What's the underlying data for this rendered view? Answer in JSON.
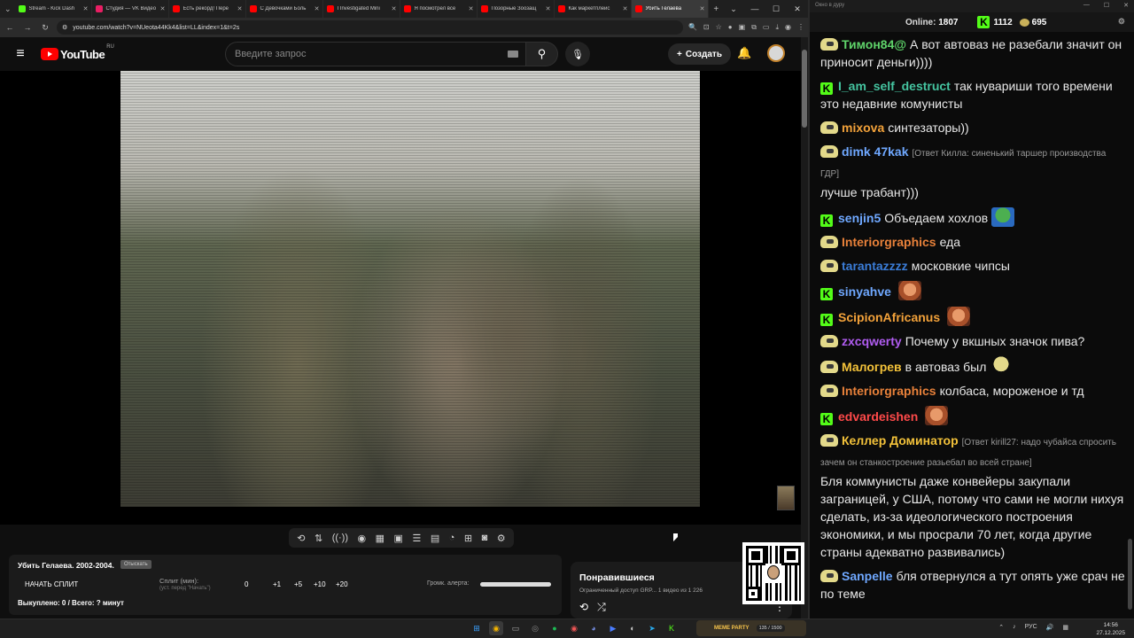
{
  "browser": {
    "tabs": [
      {
        "label": "Stream - Kick Dash",
        "color": "#53fc18"
      },
      {
        "label": "Студия — VK Видео",
        "color": "#e91e63"
      },
      {
        "label": "Есть рекорд! Пере",
        "color": "#ff0000"
      },
      {
        "label": "С Девочками Боль",
        "color": "#ff0000"
      },
      {
        "label": "I Investigated Mini",
        "color": "#ff0000"
      },
      {
        "label": "Я посмотрел все",
        "color": "#ff0000"
      },
      {
        "label": "Позорные Зоозащ",
        "color": "#ff0000"
      },
      {
        "label": "Как маркетплейс",
        "color": "#ff0000"
      },
      {
        "label": "Убить Гелаева",
        "color": "#ff0000"
      }
    ],
    "url": "youtube.com/watch?v=NUeota44Kk4&list=LL&index=1&t=2s"
  },
  "youtube": {
    "logo_text": "YouTube",
    "region": "RU",
    "search_placeholder": "Введите запрос",
    "create_label": "Создать"
  },
  "split_panel": {
    "title": "Убить Гелаева. 2002-2004.",
    "tag": "Отыскать",
    "start_label": "НАЧАТЬ СПЛИТ",
    "split_label": "Сплит (мин):",
    "split_hint": "(уст. перед \"Начать\")",
    "values": [
      "0",
      "+1",
      "+5",
      "+10",
      "+20"
    ],
    "volume_label": "Громк. алерта:",
    "footer": "Выкуплено: 0 / Всего: ? минут"
  },
  "liked_panel": {
    "title": "Понравившиеся",
    "subtitle": "Ограниченный доступ GRP... 1 видео из 1 226"
  },
  "chat": {
    "window_title": "Окно в дуру",
    "online_label": "Online:",
    "online_count": "1807",
    "k_count": "1112",
    "coin_count": "695",
    "messages": [
      {
        "badge": "pepe",
        "user": "Тимон84@",
        "color": "#5fd46a",
        "text": "А вот автоваз не разебали значит он приносит деньги))))",
        "reply": ""
      },
      {
        "badge": "k",
        "user": "I_am_self_destruct",
        "color": "#45c4a0",
        "text": "так нувариши того времени это недавние комунисты",
        "reply": ""
      },
      {
        "badge": "pepe",
        "user": "mixova",
        "color": "#f3a23a",
        "text": "синтезаторы))",
        "reply": ""
      },
      {
        "badge": "pepe",
        "user": "dimk 47kak",
        "color": "#6fa8ff",
        "text": "лучше трабант)))",
        "reply": "[Ответ Килла: синенький таршер производства ГДР]"
      },
      {
        "badge": "k",
        "user": "senjin5",
        "color": "#6fa8ff",
        "text": "Объедаем хохлов",
        "reply": "",
        "emote": "pepe"
      },
      {
        "badge": "pepe",
        "user": "Interiorgraphics",
        "color": "#e8813a",
        "text": "еда",
        "reply": ""
      },
      {
        "badge": "pepe",
        "user": "tarantazzzz",
        "color": "#3b7dd8",
        "text": "московкие чипсы",
        "reply": ""
      },
      {
        "badge": "k",
        "user": "sinyahve",
        "color": "#6fa8ff",
        "text": "",
        "reply": "",
        "emote": "face"
      },
      {
        "badge": "k",
        "user": "ScipionAfricanus",
        "color": "#f3a23a",
        "text": "",
        "reply": "",
        "emote": "face"
      },
      {
        "badge": "pepe",
        "user": "zxcqwerty",
        "color": "#b05cf0",
        "text": "Почему у вкшных значок пива?",
        "reply": ""
      },
      {
        "badge": "pepe",
        "user": "Малогрев",
        "color": "#f3c23a",
        "text": "в автоваз был",
        "reply": "",
        "emote": "blob"
      },
      {
        "badge": "pepe",
        "user": "Interiorgraphics",
        "color": "#e8813a",
        "text": "колбаса, мороженое и тд",
        "reply": ""
      },
      {
        "badge": "k",
        "user": "edvardeishen",
        "color": "#ff4a4a",
        "text": "",
        "reply": "",
        "emote": "face"
      },
      {
        "badge": "pepe",
        "user": "Келлер Доминатор",
        "color": "#f3c23a",
        "text": "Бля коммунисты даже конвейеры закупали заграницей, у США, потому что сами не могли нихуя сделать, из-за идеологического построения экономики, и мы просрали 70 лет, когда другие страны адекватно развивались)",
        "reply": "[Ответ kirill27: надо чубайса спросить зачем он станкостроение разьебал во всей стране]"
      },
      {
        "badge": "pepe",
        "user": "Sanpelle",
        "color": "#6fa8ff",
        "text": "бля отвернулся а тут опять уже срач не по теме",
        "reply": ""
      }
    ]
  },
  "taskbar": {
    "widget_title": "MEME PARTY",
    "widget_count": "135 / 1500",
    "lang": "РУС",
    "time": "14:56",
    "date": "27.12.2025"
  }
}
